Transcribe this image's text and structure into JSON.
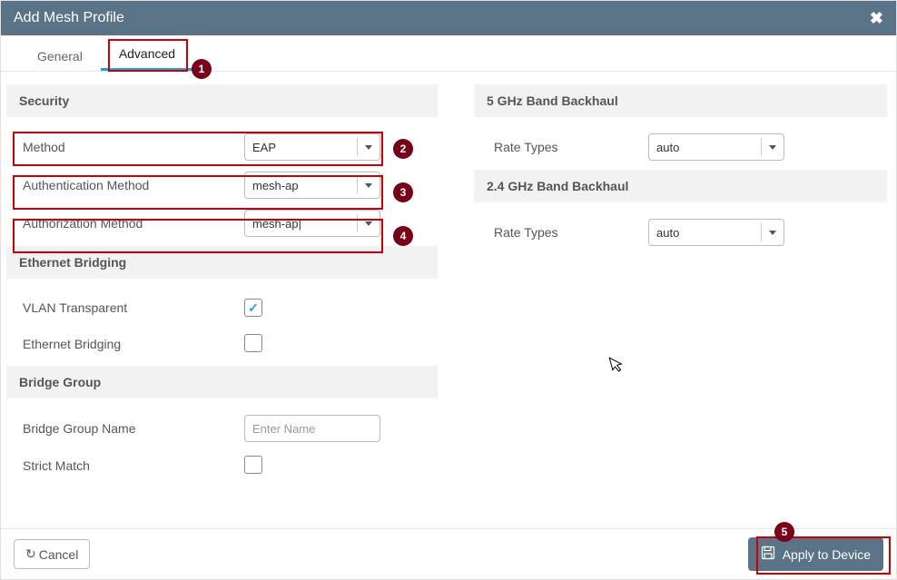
{
  "modal": {
    "title": "Add Mesh Profile"
  },
  "tabs": {
    "general": "General",
    "advanced": "Advanced"
  },
  "left": {
    "security": {
      "heading": "Security",
      "method_label": "Method",
      "method_value": "EAP",
      "auth_method_label": "Authentication Method",
      "auth_method_value": "mesh-ap",
      "authz_method_label": "Authorization Method",
      "authz_method_value": "mesh-ap|"
    },
    "eth": {
      "heading": "Ethernet Bridging",
      "vlan_trans_label": "VLAN Transparent",
      "vlan_trans_checked": true,
      "eth_bridge_label": "Ethernet Bridging",
      "eth_bridge_checked": false
    },
    "bridge": {
      "heading": "Bridge Group",
      "bgn_label": "Bridge Group Name",
      "bgn_placeholder": "Enter Name",
      "strict_label": "Strict Match",
      "strict_checked": false
    }
  },
  "right": {
    "five": {
      "heading": "5 GHz Band Backhaul",
      "rate_label": "Rate Types",
      "rate_value": "auto"
    },
    "two4": {
      "heading": "2.4 GHz Band Backhaul",
      "rate_label": "Rate Types",
      "rate_value": "auto"
    }
  },
  "footer": {
    "cancel": "Cancel",
    "apply": "Apply to Device"
  },
  "annotations": {
    "a1": "1",
    "a2": "2",
    "a3": "3",
    "a4": "4",
    "a5": "5"
  }
}
